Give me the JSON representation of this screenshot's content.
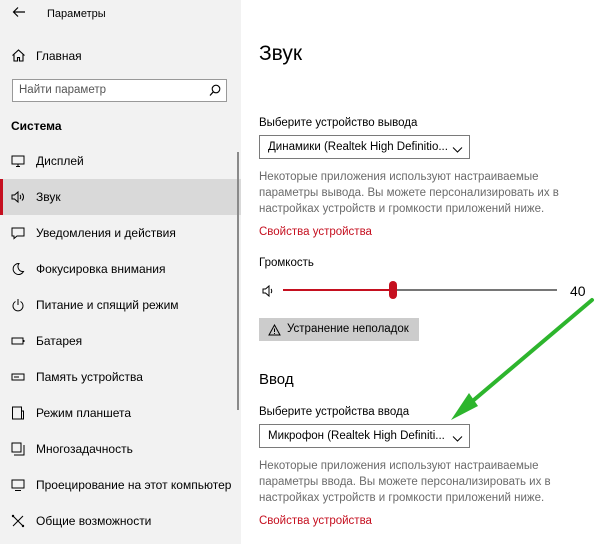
{
  "titlebar": {
    "back_icon": "back-arrow-icon",
    "title": "Параметры"
  },
  "sidebar": {
    "home_label": "Главная",
    "search_placeholder": "Найти параметр",
    "section": "Система",
    "items": [
      {
        "label": "Дисплей",
        "icon": "display-icon"
      },
      {
        "label": "Звук",
        "icon": "speaker-icon",
        "active": true
      },
      {
        "label": "Уведомления и действия",
        "icon": "notification-icon"
      },
      {
        "label": "Фокусировка внимания",
        "icon": "moon-icon"
      },
      {
        "label": "Питание и спящий режим",
        "icon": "power-icon"
      },
      {
        "label": "Батарея",
        "icon": "battery-icon"
      },
      {
        "label": "Память устройства",
        "icon": "storage-icon"
      },
      {
        "label": "Режим планшета",
        "icon": "tablet-icon"
      },
      {
        "label": "Многозадачность",
        "icon": "multitask-icon"
      },
      {
        "label": "Проецирование на этот компьютер",
        "icon": "projector-icon"
      },
      {
        "label": "Общие возможности",
        "icon": "shared-icon"
      }
    ]
  },
  "main": {
    "title": "Звук",
    "output": {
      "label": "Выберите устройство вывода",
      "device": "Динамики (Realtek High Definitio...",
      "description": "Некоторые приложения используют настраиваемые параметры вывода. Вы можете персонализировать их в настройках устройств и громкости приложений ниже.",
      "properties_link": "Свойства устройства",
      "volume_label": "Громкость",
      "volume_value": "40",
      "volume_level": 0.4,
      "troubleshoot_label": "Устранение неполадок"
    },
    "input": {
      "section_title": "Ввод",
      "label": "Выберите устройства ввода",
      "device": "Микрофон (Realtek High Definiti...",
      "description": "Некоторые приложения используют настраиваемые параметры ввода. Вы можете персонализировать их в настройках устройств и громкости приложений ниже.",
      "properties_link": "Свойства устройства"
    }
  },
  "colors": {
    "accent": "#c50f1f",
    "annotation_arrow": "#2db52d"
  }
}
